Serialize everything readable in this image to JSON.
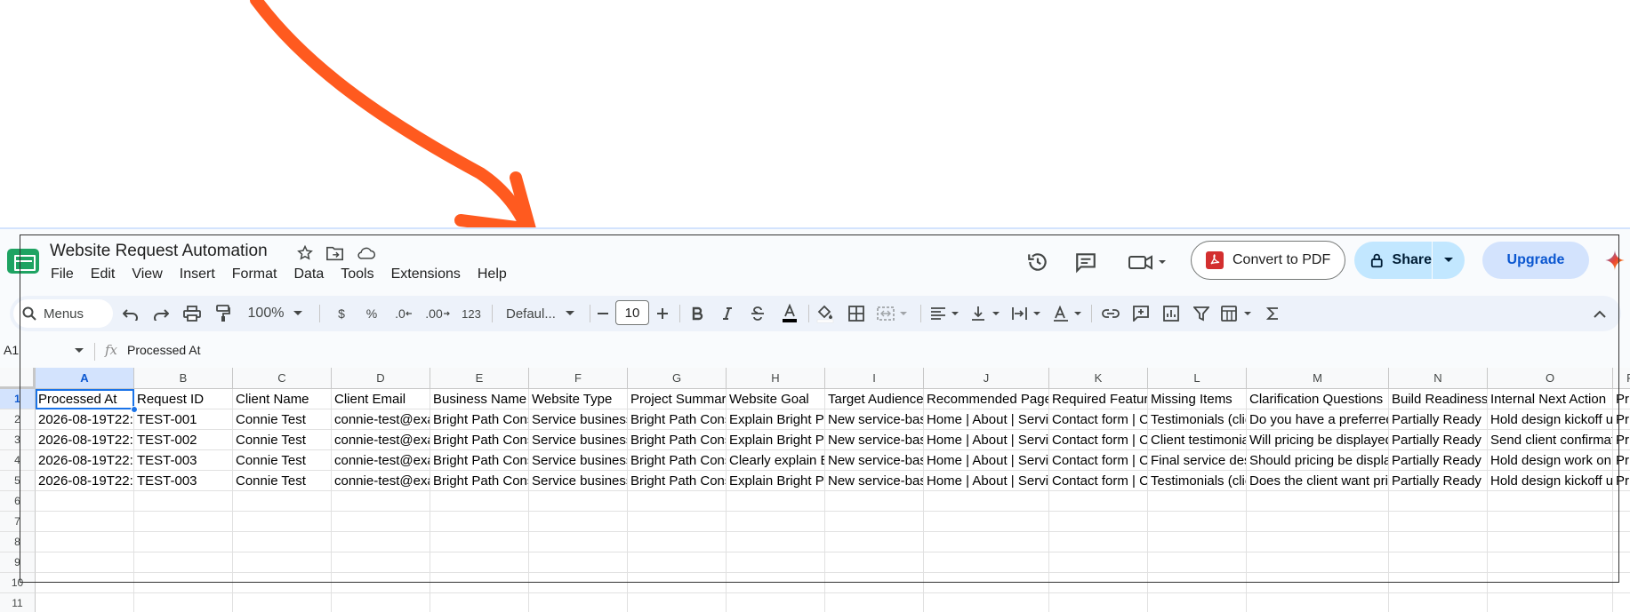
{
  "document": {
    "title": "Website Request Automation"
  },
  "menu": [
    "File",
    "Edit",
    "View",
    "Insert",
    "Format",
    "Data",
    "Tools",
    "Extensions",
    "Help"
  ],
  "header_buttons": {
    "convert_pdf": "Convert to PDF",
    "share": "Share",
    "upgrade": "Upgrade"
  },
  "toolbar": {
    "search_label": "Menus",
    "zoom": "100%",
    "currency": "$",
    "percent": "%",
    "decrease_decimal": ".0",
    "increase_decimal": ".00",
    "number_format": "123",
    "font": "Defaul...",
    "font_size": "10"
  },
  "formula_bar": {
    "cell_ref": "A1",
    "value": "Processed At"
  },
  "colors": {
    "accent": "#1a73e8",
    "share_bg": "#c2e7ff",
    "upgrade_bg": "#d3e3fd",
    "arrow": "#ff5a1f"
  },
  "columns": [
    "A",
    "B",
    "C",
    "D",
    "E",
    "F",
    "G",
    "H",
    "I",
    "J",
    "K",
    "L",
    "M",
    "N",
    "O",
    "P"
  ],
  "row_numbers": [
    "1",
    "2",
    "3",
    "4",
    "5",
    "6",
    "7",
    "8",
    "9",
    "10",
    "11"
  ],
  "rows": [
    [
      "Processed At",
      "Request ID",
      "Client Name",
      "Client Email",
      "Business Name",
      "Website Type",
      "Project Summar",
      "Website Goal",
      "Target Audience",
      "Recommended Page",
      "Required Featur",
      "Missing Items",
      "Clarification Questions",
      "Build Readiness",
      "Internal Next Action",
      "Pr"
    ],
    [
      "2026-08-19T22::",
      "TEST-001",
      "Connie Test",
      "connie-test@exa",
      "Bright Path Cons",
      "Service business",
      "Bright Path Cons",
      "Explain Bright Pa",
      "New service-bas",
      "Home | About | Servic",
      "Contact form | C",
      "Testimonials (clie",
      "Do you have a preferred",
      "Partially Ready",
      "Hold design kickoff ur",
      "Pr"
    ],
    [
      "2026-08-19T22::",
      "TEST-002",
      "Connie Test",
      "connie-test@exa",
      "Bright Path Cons",
      "Service business",
      "Bright Path Cons",
      "Explain Bright Pa",
      "New service-bas",
      "Home | About | Servic",
      "Contact form | C",
      "Client testimonia",
      "Will pricing be displayed",
      "Partially Ready",
      "Send client confirmat",
      "Pr"
    ],
    [
      "2026-08-19T22::",
      "TEST-003",
      "Connie Test",
      "connie-test@exa",
      "Bright Path Cons",
      "Service business",
      "Bright Path Cons",
      "Clearly explain B",
      "New service-bas",
      "Home | About | Servic",
      "Contact form | C",
      "Final service des",
      "Should pricing be displa",
      "Partially Ready",
      "Hold design work on",
      "Pr"
    ],
    [
      "2026-08-19T22::",
      "TEST-003",
      "Connie Test",
      "connie-test@exa",
      "Bright Path Cons",
      "Service business",
      "Bright Path Cons",
      "Explain Bright Pa",
      "New service-bas",
      "Home | About | Servic",
      "Contact form | C",
      "Testimonials (clie",
      "Does the client want pric",
      "Partially Ready",
      "Hold design kickoff ur",
      "Pr"
    ]
  ]
}
